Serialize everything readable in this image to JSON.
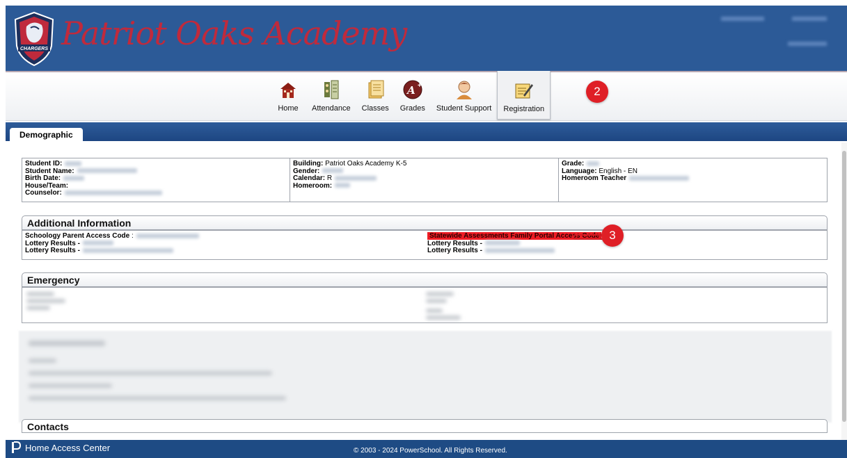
{
  "header": {
    "school_name": "Patriot Oaks Academy",
    "logo_text": "CHARGERS"
  },
  "nav": {
    "items": [
      {
        "label": "Home",
        "icon": "home-icon"
      },
      {
        "label": "Attendance",
        "icon": "attendance-icon"
      },
      {
        "label": "Classes",
        "icon": "classes-icon"
      },
      {
        "label": "Grades",
        "icon": "grades-icon"
      },
      {
        "label": "Student Support",
        "icon": "student-support-icon"
      },
      {
        "label": "Registration",
        "icon": "registration-icon"
      }
    ],
    "active": "Registration",
    "callout_2": "2"
  },
  "tabs": {
    "active_tab": "Demographic"
  },
  "student_info": {
    "student_id_label": "Student ID:",
    "student_name_label": "Student Name:",
    "birth_date_label": "Birth Date:",
    "house_team_label": "House/Team:",
    "counselor_label": "Counselor:",
    "building_label": "Building:",
    "building_value": "Patriot Oaks Academy K-5",
    "gender_label": "Gender:",
    "calendar_label": "Calendar:",
    "calendar_value": "R",
    "homeroom_label": "Homeroom:",
    "grade_label": "Grade:",
    "language_label": "Language:",
    "language_value": "English - EN",
    "homeroom_teacher_label": "Homeroom Teacher"
  },
  "additional_info": {
    "title": "Additional Information",
    "schoology_label": "Schoology Parent Access Code",
    "schoology_sep": ":",
    "lottery_label_1": "Lottery Results -",
    "lottery_label_2": "Lottery Results -",
    "statewide_label": "Statewide Assessments Family Portal Access Code",
    "lottery_label_3": "Lottery Results -",
    "lottery_label_4": "Lottery Results -",
    "callout_3": "3"
  },
  "emergency": {
    "title": "Emergency"
  },
  "contacts": {
    "title": "Contacts"
  },
  "footer": {
    "brand": "Home Access Center",
    "copyright": "© 2003 - 2024 PowerSchool. All Rights Reserved."
  },
  "colors": {
    "header_blue": "#2c5a97",
    "school_name_red": "#c02a3c",
    "callout_red": "#df1f26",
    "highlight_red": "#ee1c24",
    "footer_blue": "#1e4b84"
  }
}
